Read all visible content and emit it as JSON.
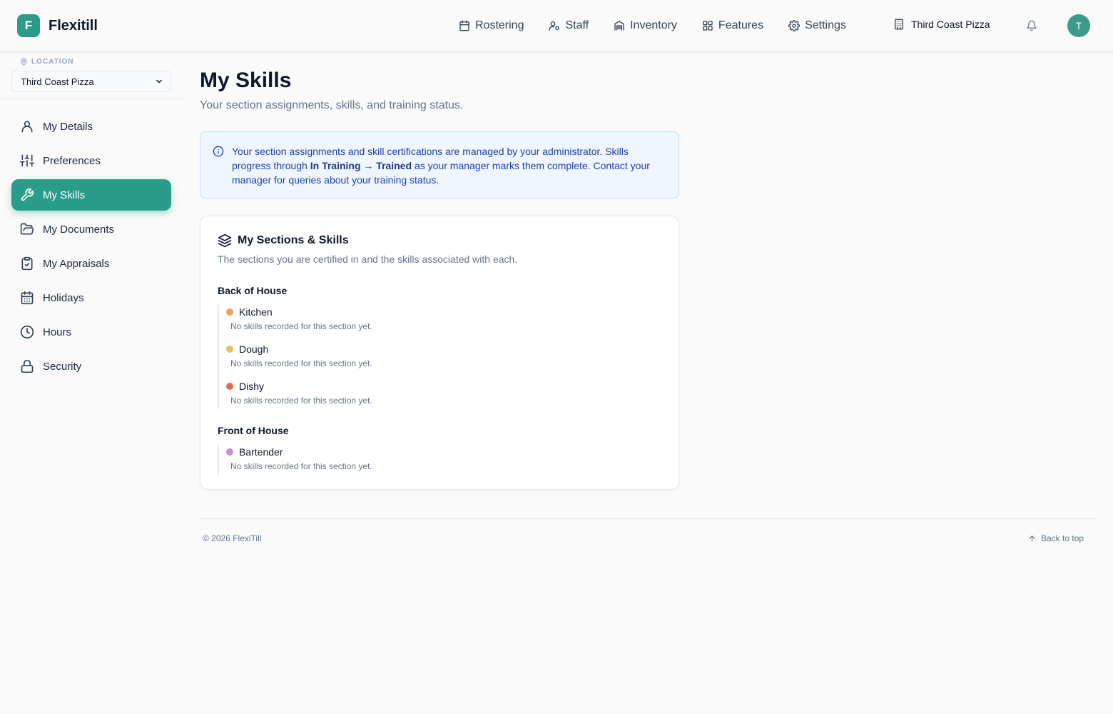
{
  "brand": {
    "initial": "F",
    "name": "Flexitill"
  },
  "nav": {
    "items": [
      {
        "label": "Rostering",
        "icon": "calendar-icon"
      },
      {
        "label": "Staff",
        "icon": "user-cog-icon"
      },
      {
        "label": "Inventory",
        "icon": "warehouse-icon"
      },
      {
        "label": "Features",
        "icon": "grid-icon"
      },
      {
        "label": "Settings",
        "icon": "gear-icon"
      }
    ],
    "location": "Third Coast Pizza",
    "avatar_initial": "T"
  },
  "sidebar": {
    "location_label": "LOCATION",
    "location_value": "Third Coast Pizza",
    "items": [
      {
        "label": "My Details",
        "icon": "user-icon"
      },
      {
        "label": "Preferences",
        "icon": "sliders-icon"
      },
      {
        "label": "My Skills",
        "icon": "wrench-icon",
        "active": true
      },
      {
        "label": "My Documents",
        "icon": "folder-icon"
      },
      {
        "label": "My Appraisals",
        "icon": "clipboard-check-icon"
      },
      {
        "label": "Holidays",
        "icon": "calendar-days-icon"
      },
      {
        "label": "Hours",
        "icon": "clock-icon"
      },
      {
        "label": "Security",
        "icon": "lock-icon"
      }
    ]
  },
  "main": {
    "title": "My Skills",
    "subtitle": "Your section assignments, skills, and training status.",
    "info": {
      "text_1": "Your section assignments and skill certifications are managed by your administrator. Skills progress through ",
      "bold_1": "In Training",
      "arrow": " → ",
      "bold_2": "Trained",
      "text_2": " as your manager marks them complete. Contact your manager for queries about your training status."
    },
    "card": {
      "title": "My Sections & Skills",
      "description": "The sections you are certified in and the skills associated with each.",
      "groups": [
        {
          "title": "Back of House",
          "sections": [
            {
              "name": "Kitchen",
              "color": "#f0a060",
              "empty": "No skills recorded for this section yet."
            },
            {
              "name": "Dough",
              "color": "#e8c060",
              "empty": "No skills recorded for this section yet."
            },
            {
              "name": "Dishy",
              "color": "#e0704c",
              "empty": "No skills recorded for this section yet."
            }
          ]
        },
        {
          "title": "Front of House",
          "sections": [
            {
              "name": "Bartender",
              "color": "#c88ed0",
              "empty": "No skills recorded for this section yet."
            }
          ]
        }
      ]
    }
  },
  "footer": {
    "copyright": "© 2026 FlexiTill",
    "back_to_top": "Back to top"
  },
  "colors": {
    "accent": "#2a9d8a",
    "info_bg": "#eff6ff",
    "info_text": "#1e40af"
  }
}
